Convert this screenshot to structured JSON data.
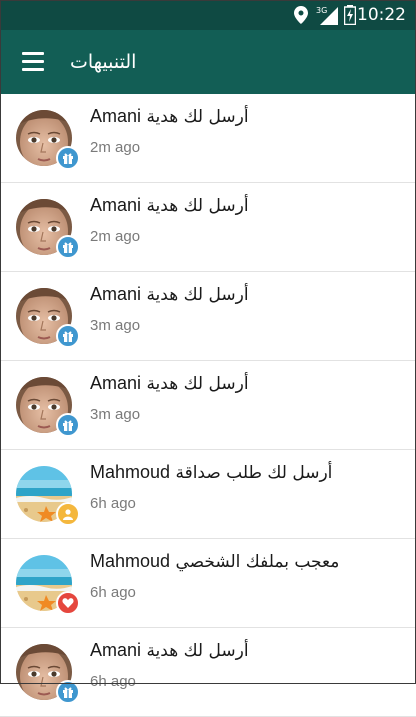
{
  "status_bar": {
    "time": "10:22",
    "network_label": "3G",
    "icons": [
      "location-icon",
      "signal-icon",
      "battery-icon"
    ]
  },
  "app_bar": {
    "title": "التنبيهات",
    "menu_icon": "hamburger-menu-icon",
    "color": "#125e55"
  },
  "notifications": [
    {
      "name": "Amani",
      "message": "أرسل لك هدية",
      "time": "2m ago",
      "avatar": "girl-photo",
      "badge": "gift-icon",
      "badge_color": "#3f97cf"
    },
    {
      "name": "Amani",
      "message": "أرسل لك هدية",
      "time": "2m ago",
      "avatar": "girl-photo",
      "badge": "gift-icon",
      "badge_color": "#3f97cf"
    },
    {
      "name": "Amani",
      "message": "أرسل لك هدية",
      "time": "3m ago",
      "avatar": "girl-photo",
      "badge": "gift-icon",
      "badge_color": "#3f97cf"
    },
    {
      "name": "Amani",
      "message": "أرسل لك هدية",
      "time": "3m ago",
      "avatar": "girl-photo",
      "badge": "gift-icon",
      "badge_color": "#3f97cf"
    },
    {
      "name": "Mahmoud",
      "message": "أرسل لك طلب صداقة",
      "time": "6h ago",
      "avatar": "beach-photo",
      "badge": "person-icon",
      "badge_color": "#f4b73d"
    },
    {
      "name": "Mahmoud",
      "message": "معجب بملفك الشخصي",
      "time": "6h ago",
      "avatar": "beach-photo",
      "badge": "heart-icon",
      "badge_color": "#e5473e"
    },
    {
      "name": "Amani",
      "message": "أرسل لك هدية",
      "time": "6h ago",
      "avatar": "girl-photo",
      "badge": "gift-icon",
      "badge_color": "#3f97cf"
    }
  ]
}
